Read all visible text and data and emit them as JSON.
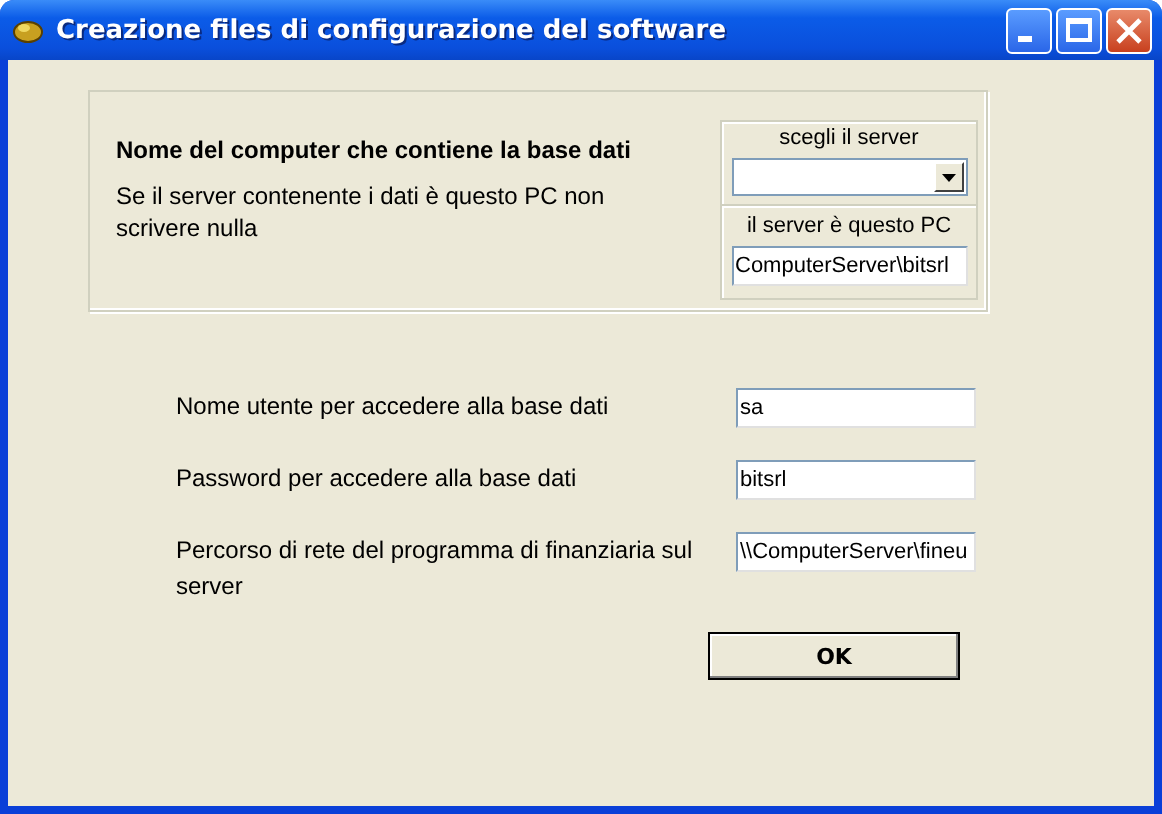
{
  "window": {
    "title": "Creazione files di configurazione del software"
  },
  "server_group": {
    "heading": "Nome del computer che contiene la base dati",
    "note": "Se il server contenente i dati è questo PC non scrivere nulla",
    "choose_label": "scegli il server",
    "combo": {
      "kind": "dropdown"
    },
    "this_pc_label": "il server è questo PC",
    "this_pc_value": "ComputerServer\\bitsrl"
  },
  "fields": [
    {
      "label": "Nome utente per accedere alla base dati",
      "value": "sa"
    },
    {
      "label": "Password per accedere alla base dati",
      "value": "bitsrl"
    },
    {
      "label": "Percorso di rete del programma di finanziaria sul server",
      "value": "\\\\ComputerServer\\fineu"
    }
  ],
  "ok_button": "OK"
}
